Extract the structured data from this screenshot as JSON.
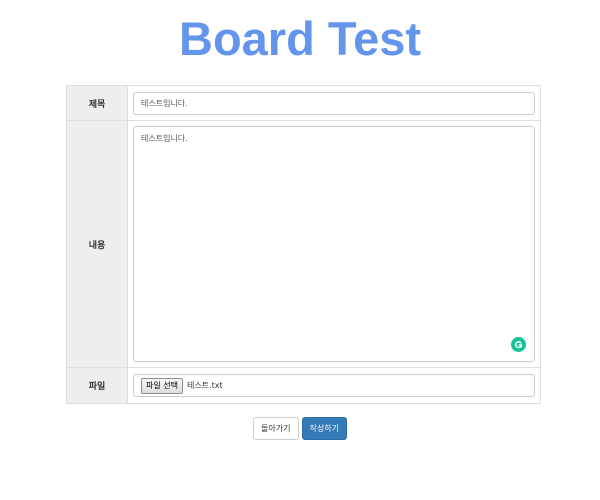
{
  "header": {
    "title": "Board Test"
  },
  "form": {
    "title_label": "제목",
    "title_value": "테스트입니다.",
    "content_label": "내용",
    "content_value": "테스트입니다.",
    "file_label": "파일",
    "file_button_label": "파일 선택",
    "file_name": "테스트.txt"
  },
  "actions": {
    "back_label": "돌아가기",
    "submit_label": "작성하기"
  },
  "icons": {
    "grammarly": "grammarly-icon"
  },
  "colors": {
    "title": "#6495ED",
    "primary": "#337ab7",
    "label_bg": "#eeeeee",
    "grammarly": "#15C39A"
  }
}
